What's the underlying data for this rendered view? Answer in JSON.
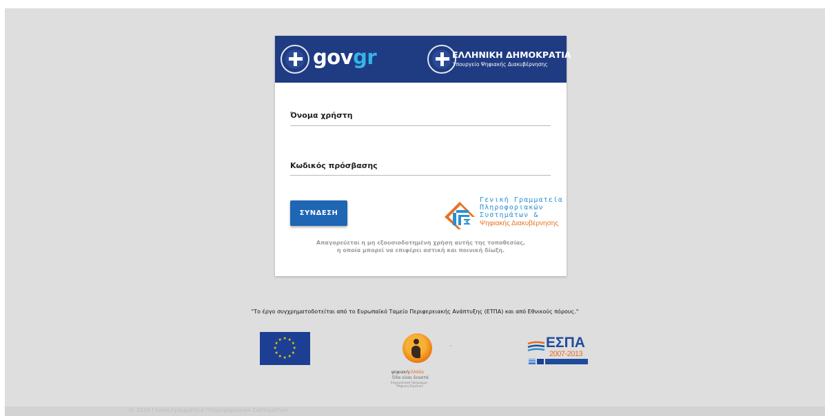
{
  "header": {
    "gov_logo_main": "gov",
    "gov_logo_accent": "gr",
    "republic_title": "ΕΛΛΗΝΙΚΗ ΔΗΜΟΚΡΑΤΙΑ",
    "ministry": "Υπουργείο Ψηφιακής Διακυβέρνησης"
  },
  "form": {
    "username_label": "Όνομα χρήστη",
    "username_value": "",
    "password_label": "Κωδικός πρόσβασης",
    "password_value": "",
    "login_button": "ΣΥΝΔΕΣΗ"
  },
  "gsis_logo": {
    "line1": "Γενική Γραμματεία",
    "line2": "Πληροφοριακών",
    "line3": "Συστημάτων &",
    "line4": "Ψηφιακής Διακυβέρνησης"
  },
  "warning": {
    "line1": "Απαγορεύεται η μη εξουσιοδοτημένη χρήση αυτής της τοποθεσίας,",
    "line2": "η οποία μπορεί να επιφέρει αστική και ποινική δίωξη."
  },
  "cofunding_text": "\"Το έργο συγχρηματοδοτείται από το Ευρωπαϊκό Ταμείο Περιφερειακής Ανάπτυξης (ΕΤΠΑ) και από Εθνικούς πόρους.\"",
  "digital_greece": {
    "brand_part1": "ψηφιακή",
    "brand_part2": "ελλάδα",
    "slogan": "Όλα είναι δυνατά",
    "program_line1": "Επιχειρησιακό Πρόγραμμα",
    "program_line2": "\"Ψηφιακή Σύγκλιση\""
  },
  "espa": {
    "title": "ΕΣΠΑ",
    "years": "2007-2013"
  },
  "footer": {
    "copyright": "© 2016 Γενική Γραμματεία Πληροφοριακών Συστημάτων"
  },
  "colors": {
    "header_blue": "#1f3b82",
    "button_blue": "#1f66b5",
    "gov_accent": "#36b3e8",
    "gsis_orange": "#e57425"
  }
}
